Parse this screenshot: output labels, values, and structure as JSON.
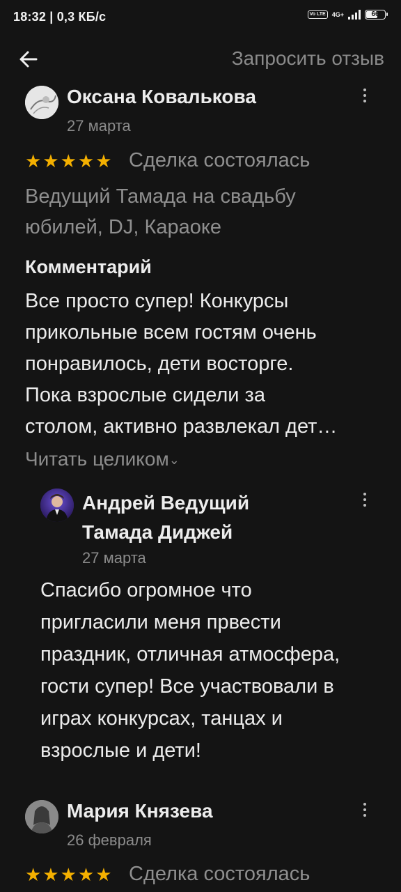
{
  "status": {
    "time": "18:32",
    "speed": "0,3 КБ/с",
    "volte": "Vo LTE",
    "network": "4G+",
    "battery": "66",
    "battery_level": 0.66
  },
  "header": {
    "back_icon": "arrow-left-icon",
    "request_review": "Запросить отзыв"
  },
  "reviews": [
    {
      "author": "Оксана Ковалькова",
      "date": "27 марта",
      "rating": 5,
      "stars": "★★★★★",
      "deal_status": "Сделка состоялась",
      "service_line1": "Ведущий Тамада на свадьбу",
      "service_line2": "юбилей, DJ, Караоке",
      "comment_heading": "Комментарий",
      "comment_lines": [
        "Все просто супер! Конкурсы",
        "прикольные всем гостям очень",
        "понравилось, дети восторге.",
        "Пока взрослые сидели за",
        "столом, активно развлекал дет…"
      ],
      "read_more": "Читать целиком",
      "reply": {
        "author_line1": "Андрей Ведущий",
        "author_line2": "Тамада Диджей",
        "date": "27 марта",
        "lines": [
          "Спасибо огромное что",
          "пригласили  меня првести",
          "праздник, отличная атмосфера,",
          "гости супер! Все участвовали в",
          "играх конкурсах, танцах и",
          "взрослые и дети!"
        ]
      }
    },
    {
      "author": "Мария Князева",
      "date": "26 февраля",
      "rating": 5,
      "stars": "★★★★★",
      "deal_status": "Сделка состоялась"
    }
  ]
}
